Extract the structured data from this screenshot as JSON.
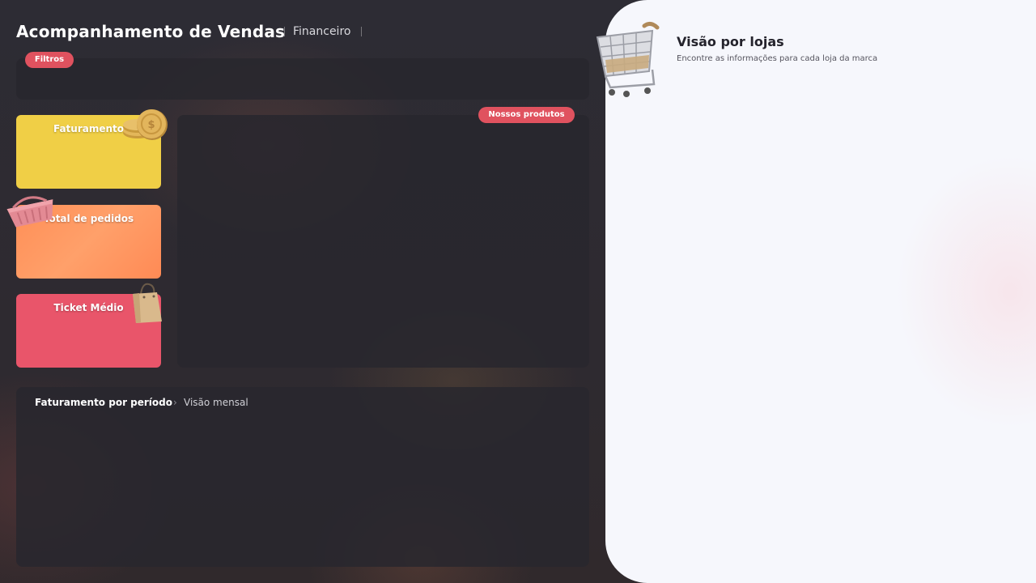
{
  "header": {
    "title": "Acompanhamento de Vendas",
    "subtitle": "Financeiro"
  },
  "filters": {
    "label": "Filtros"
  },
  "products": {
    "label": "Nossos produtos"
  },
  "kpis": [
    {
      "label": "Faturamento",
      "icon": "coins-icon",
      "color": "#f0cf46"
    },
    {
      "label": "Total de pedidos",
      "icon": "basket-icon",
      "color": "#ff9860"
    },
    {
      "label": "Ticket Médio",
      "icon": "shopping-bag-icon",
      "color": "#e9556a"
    }
  ],
  "period": {
    "title": "Faturamento por período",
    "separator": "›",
    "view": "Visão mensal"
  },
  "stores": {
    "title": "Visão por lojas",
    "subtitle": "Encontre as informações para cada loja da marca",
    "icon": "shopping-cart-icon"
  },
  "colors": {
    "accent": "#e0525f",
    "dark_bg": "#2c2b33",
    "light_bg": "#f6f7fc"
  }
}
